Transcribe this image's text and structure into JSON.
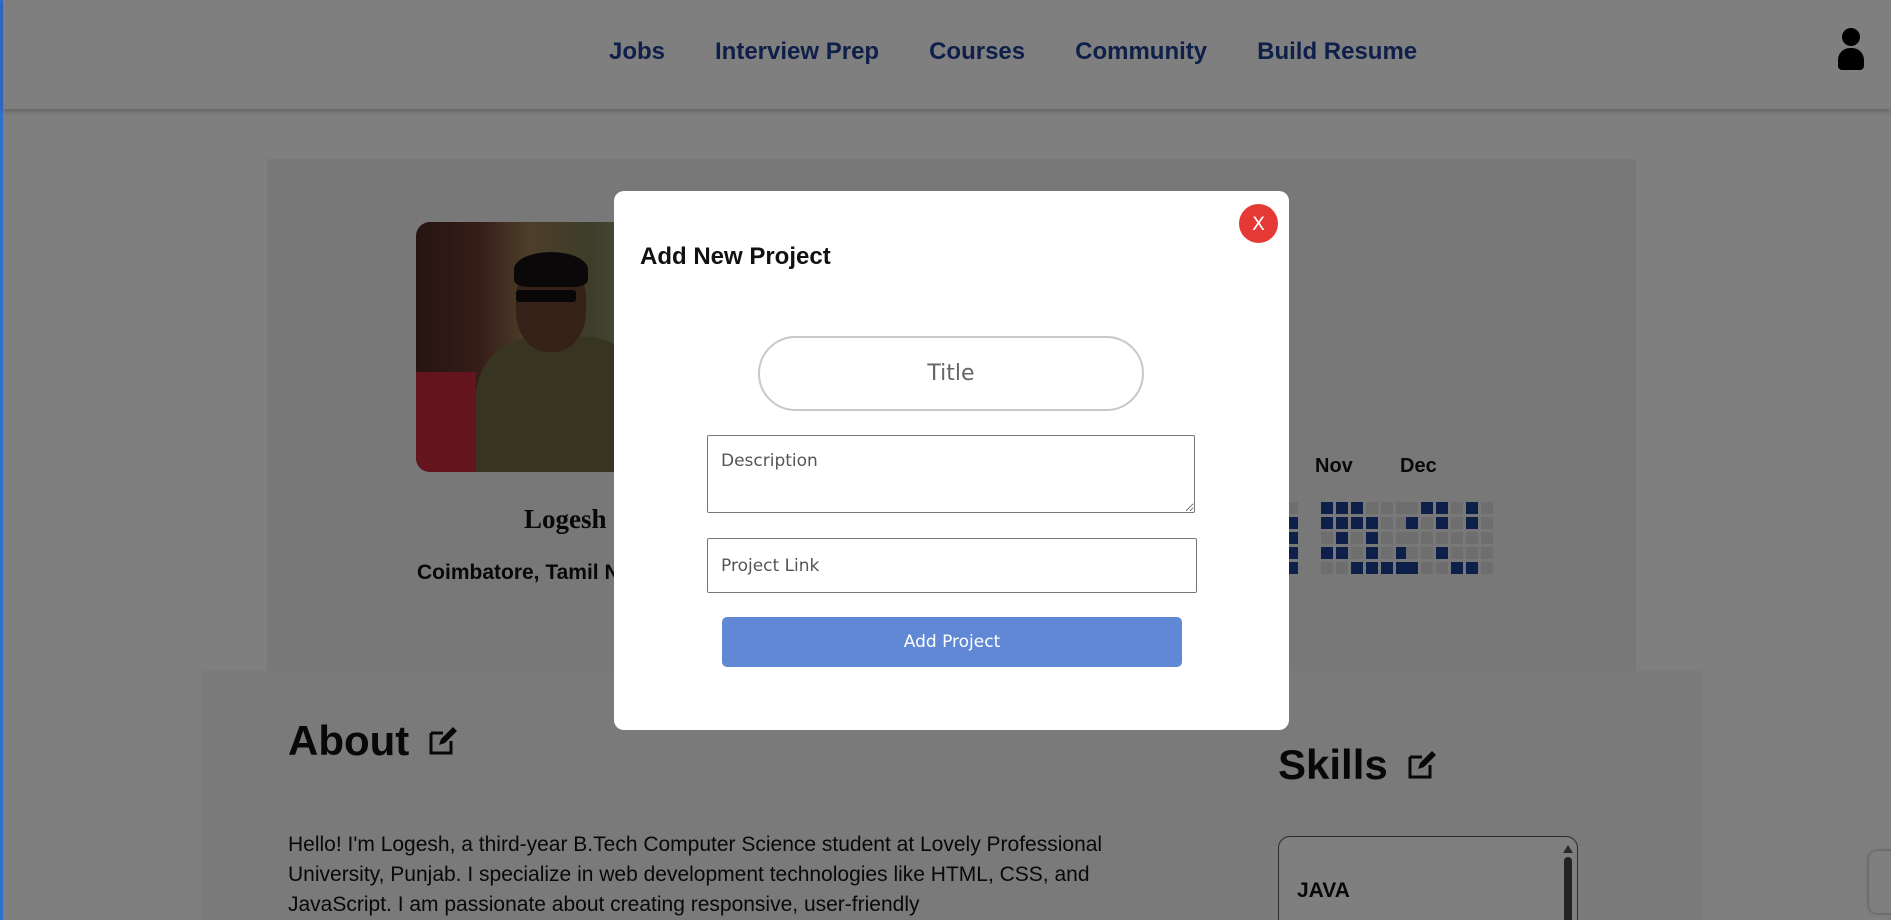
{
  "nav": {
    "links": [
      "Jobs",
      "Interview Prep",
      "Courses",
      "Community",
      "Build Resume"
    ],
    "user_icon": "user-icon"
  },
  "profile": {
    "name": "Logesh",
    "location": "Coimbatore, Tamil Nadu",
    "activity_months": [
      "Nov",
      "Dec"
    ]
  },
  "about": {
    "title": "About",
    "text": "Hello! I'm Logesh, a third-year B.Tech Computer Science student at Lovely Professional University, Punjab. I specialize in web development technologies like HTML, CSS, and JavaScript. I am passionate about creating responsive, user-friendly"
  },
  "skills": {
    "title": "Skills",
    "items": [
      "JAVA"
    ]
  },
  "modal": {
    "title": "Add New Project",
    "close_label": "X",
    "title_placeholder": "Title",
    "description_placeholder": "Description",
    "link_placeholder": "Project Link",
    "submit_label": "Add Project"
  },
  "colors": {
    "nav_text": "#1d3f93",
    "close_button": "#e53935",
    "submit_button": "#6088d4",
    "heatmap_active": "#1d3f93"
  }
}
